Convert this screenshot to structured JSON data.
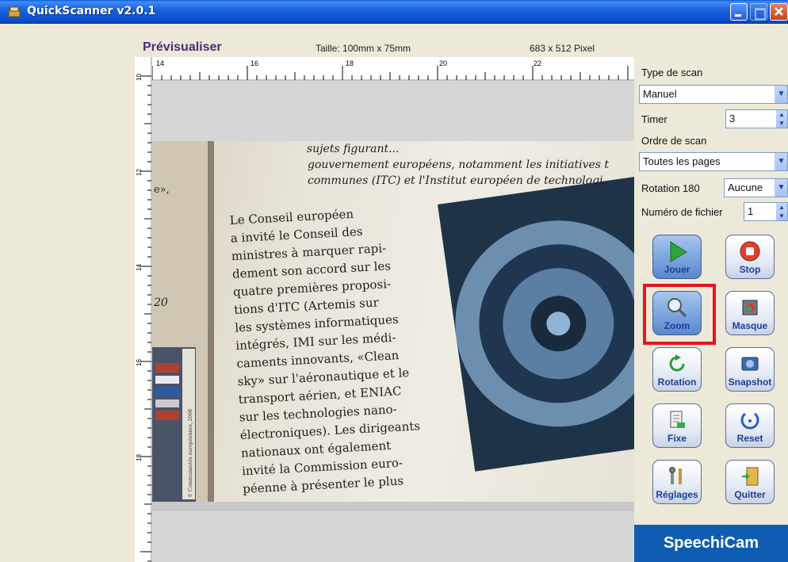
{
  "window": {
    "title": "QuickScanner v2.0.1"
  },
  "preview": {
    "title": "Prévisualiser",
    "size_text": "Taille: 100mm x 75mm",
    "pixel_text": "683 x 512 Pixel"
  },
  "ruler": {
    "top_labels": [
      "14",
      "16",
      "18",
      "20",
      "22"
    ],
    "left_labels": [
      "10",
      "12",
      "14",
      "16",
      "18"
    ]
  },
  "scan_text": {
    "heading_lines": [
      "sujets figurant...",
      "gouvernement européens, notamment les initiatives t",
      "communes (ITC) et l'Institut européen de technologi"
    ],
    "margin_a": "e»,",
    "margin_b": "20",
    "body_lines": [
      "Le Conseil européen",
      "a invité le Conseil des",
      "ministres à marquer rapi-",
      "dement son accord sur les",
      "quatre premières proposi-",
      "tions d'ITC (Artemis sur",
      "les systèmes informatiques",
      "intégrés, IMI sur les médi-",
      "caments innovants, «Clean",
      "sky» sur l'aéronautique et le",
      "transport aérien, et ENIAC",
      "sur les technologies nano-",
      "électroniques). Les dirigeants",
      "nationaux ont également",
      "invité la Commission euro-",
      "péenne à présenter le plus"
    ],
    "stamp_text": "© Communautés européennes, 2008"
  },
  "controls": {
    "scan_type_label": "Type de scan",
    "scan_type_value": "Manuel",
    "timer_label": "Timer",
    "timer_value": "3",
    "scan_order_label": "Ordre de scan",
    "scan_order_value": "Toutes les pages",
    "rotation_label": "Rotation 180",
    "rotation_value": "Aucune",
    "file_number_label": "Numéro de fichier",
    "file_number_value": "1"
  },
  "buttons": {
    "play": "Jouer",
    "stop": "Stop",
    "zoom": "Zoom",
    "mask": "Masque",
    "rotation": "Rotation",
    "snapshot": "Snapshot",
    "fixe": "Fixe",
    "reset": "Reset",
    "settings": "Réglages",
    "quit": "Quitter"
  },
  "brand": "SpeechiCam",
  "colors": {
    "titlebar": "#0a4fd0",
    "highlight": "#e8141e",
    "brand_bg": "#0e5db2",
    "button_label": "#1a3f9c",
    "preview_title": "#4a2d7a"
  }
}
